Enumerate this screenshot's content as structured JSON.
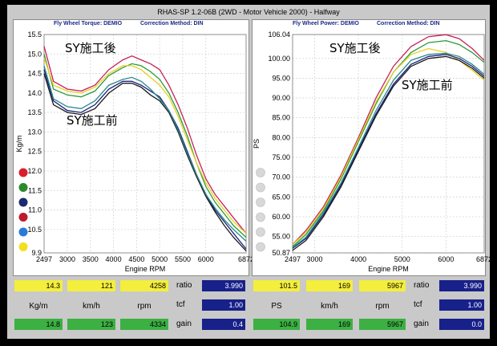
{
  "window_title": "RHAS-SP 1.2-06B  (2WD - Motor Vehicle 2000) - Halfway",
  "panels": {
    "torque": {
      "title": "Fly Wheel Torque: DEMIO",
      "method": "Correction Method: DIN"
    },
    "power": {
      "title": "Fly Wheel Power: DEMIO",
      "method": "Correction Method: DIN"
    }
  },
  "legend_colors": [
    "#d81e2c",
    "#2b8a2b",
    "#1c2a6e",
    "#c0192c",
    "#2a7ad8",
    "#f0e020"
  ],
  "power_dot_color": "#d8d8d8",
  "chart_data": [
    {
      "type": "line",
      "title": "Fly Wheel Torque: DEMIO",
      "xlabel": "Engine RPM",
      "ylabel": "Kg/m",
      "xlim": [
        2497,
        6872
      ],
      "ylim": [
        9.9,
        15.5
      ],
      "xticks": [
        "2497",
        "3000",
        "3500",
        "4000",
        "4500",
        "5000",
        "5500",
        "6000",
        "6872"
      ],
      "yticks": [
        "9.9",
        "10.5",
        "11.0",
        "11.5",
        "12.0",
        "12.5",
        "13.0",
        "13.5",
        "14.0",
        "14.5",
        "15.0",
        "15.5"
      ],
      "annotations": [
        "SY施工後",
        "SY施工前"
      ],
      "series": [
        {
          "color": "#c8205a",
          "x": [
            2497,
            2700,
            3000,
            3300,
            3600,
            3900,
            4200,
            4400,
            4600,
            4800,
            5000,
            5200,
            5400,
            5600,
            5800,
            6000,
            6200,
            6400,
            6600,
            6872
          ],
          "y": [
            15.2,
            14.3,
            14.1,
            14.05,
            14.2,
            14.6,
            14.85,
            14.95,
            14.85,
            14.75,
            14.6,
            14.2,
            13.7,
            13.1,
            12.4,
            11.8,
            11.4,
            11.1,
            10.8,
            10.4
          ]
        },
        {
          "color": "#2a9a3a",
          "x": [
            2497,
            2700,
            3000,
            3300,
            3600,
            3900,
            4200,
            4400,
            4600,
            4800,
            5000,
            5200,
            5400,
            5600,
            5800,
            6000,
            6200,
            6400,
            6600,
            6872
          ],
          "y": [
            15.0,
            14.1,
            13.95,
            13.9,
            14.05,
            14.45,
            14.65,
            14.75,
            14.7,
            14.55,
            14.35,
            14.0,
            13.5,
            12.9,
            12.2,
            11.6,
            11.2,
            10.9,
            10.6,
            10.3
          ]
        },
        {
          "color": "#e8d020",
          "x": [
            2497,
            2700,
            3000,
            3300,
            3600,
            3900,
            4200,
            4400,
            4600,
            4800,
            5000,
            5200,
            5400,
            5600,
            5800,
            6000,
            6200,
            6400,
            6600,
            6872
          ],
          "y": [
            14.9,
            14.2,
            14.05,
            14.0,
            14.15,
            14.5,
            14.7,
            14.7,
            14.6,
            14.4,
            14.2,
            13.9,
            13.4,
            12.8,
            12.2,
            11.7,
            11.3,
            11.0,
            10.7,
            10.4
          ]
        },
        {
          "color": "#1a2080",
          "x": [
            2497,
            2700,
            3000,
            3300,
            3600,
            3900,
            4200,
            4400,
            4600,
            4800,
            5000,
            5200,
            5400,
            5600,
            5800,
            6000,
            6200,
            6400,
            6600,
            6872
          ],
          "y": [
            14.6,
            13.8,
            13.55,
            13.5,
            13.7,
            14.1,
            14.3,
            14.3,
            14.2,
            14.05,
            13.9,
            13.55,
            13.1,
            12.5,
            11.9,
            11.4,
            11.0,
            10.7,
            10.4,
            10.0
          ]
        },
        {
          "color": "#1a1a1a",
          "x": [
            2497,
            2700,
            3000,
            3300,
            3600,
            3900,
            4200,
            4400,
            4600,
            4800,
            5000,
            5200,
            5400,
            5600,
            5800,
            6000,
            6200,
            6400,
            6600,
            6872
          ],
          "y": [
            14.5,
            13.7,
            13.5,
            13.45,
            13.6,
            14.0,
            14.25,
            14.25,
            14.15,
            13.95,
            13.8,
            13.5,
            13.0,
            12.4,
            11.85,
            11.35,
            10.95,
            10.6,
            10.3,
            9.95
          ]
        },
        {
          "color": "#2a8a8a",
          "x": [
            2497,
            2700,
            3000,
            3300,
            3600,
            3900,
            4200,
            4400,
            4600,
            4800,
            5000,
            5200,
            5400,
            5600,
            5800,
            6000,
            6200,
            6400,
            6600,
            6872
          ],
          "y": [
            14.7,
            13.85,
            13.65,
            13.6,
            13.8,
            14.2,
            14.35,
            14.4,
            14.3,
            14.1,
            13.85,
            13.55,
            13.05,
            12.45,
            11.9,
            11.4,
            11.05,
            10.75,
            10.5,
            10.2
          ]
        }
      ]
    },
    {
      "type": "line",
      "title": "Fly Wheel Power: DEMIO",
      "xlabel": "Engine RPM",
      "ylabel": "PS",
      "xlim": [
        2497,
        6872
      ],
      "ylim": [
        50.87,
        106.04
      ],
      "xticks": [
        "2497",
        "3000",
        "4000",
        "5000",
        "6000",
        "6872"
      ],
      "yticks": [
        "50.87",
        "55.00",
        "60.00",
        "65.00",
        "70.00",
        "75.00",
        "80.00",
        "85.00",
        "90.00",
        "95.00",
        "100.00",
        "106.04"
      ],
      "annotations": [
        "SY施工後",
        "SY施工前"
      ],
      "series": [
        {
          "color": "#c8205a",
          "x": [
            2497,
            2800,
            3200,
            3600,
            4000,
            4400,
            4800,
            5200,
            5600,
            6000,
            6300,
            6600,
            6872
          ],
          "y": [
            53.0,
            56.5,
            62.5,
            70.5,
            80.0,
            90.0,
            98.0,
            103.0,
            105.5,
            106.0,
            105.0,
            102.5,
            99.5
          ]
        },
        {
          "color": "#2a9a3a",
          "x": [
            2497,
            2800,
            3200,
            3600,
            4000,
            4400,
            4800,
            5200,
            5600,
            6000,
            6300,
            6600,
            6872
          ],
          "y": [
            52.5,
            55.5,
            61.5,
            69.5,
            79.0,
            88.5,
            96.5,
            101.5,
            104.0,
            104.5,
            103.5,
            101.5,
            99.0
          ]
        },
        {
          "color": "#e8d020",
          "x": [
            2497,
            2800,
            3200,
            3600,
            4000,
            4400,
            4800,
            5200,
            5600,
            6000,
            6300,
            6600,
            6872
          ],
          "y": [
            53.0,
            56.0,
            62.0,
            70.0,
            79.5,
            89.0,
            96.5,
            101.0,
            102.5,
            101.5,
            99.5,
            97.0,
            94.5
          ]
        },
        {
          "color": "#1a2080",
          "x": [
            2497,
            2800,
            3200,
            3600,
            4000,
            4400,
            4800,
            5200,
            5600,
            6000,
            6300,
            6600,
            6872
          ],
          "y": [
            52.0,
            54.5,
            60.5,
            68.0,
            77.0,
            86.0,
            93.5,
            98.5,
            100.5,
            101.0,
            100.0,
            98.0,
            95.5
          ]
        },
        {
          "color": "#1a1a1a",
          "x": [
            2497,
            2800,
            3200,
            3600,
            4000,
            4400,
            4800,
            5200,
            5600,
            6000,
            6300,
            6600,
            6872
          ],
          "y": [
            51.5,
            54.0,
            60.0,
            67.5,
            76.5,
            85.5,
            93.0,
            98.0,
            100.0,
            100.5,
            99.5,
            97.5,
            95.0
          ]
        },
        {
          "color": "#2a8a8a",
          "x": [
            2497,
            2800,
            3200,
            3600,
            4000,
            4400,
            4800,
            5200,
            5600,
            6000,
            6300,
            6600,
            6872
          ],
          "y": [
            52.2,
            54.8,
            61.0,
            68.5,
            77.5,
            86.8,
            94.5,
            99.5,
            101.0,
            101.3,
            100.5,
            98.5,
            96.0
          ]
        }
      ]
    }
  ],
  "readouts": {
    "torque": {
      "row1": [
        "14.3",
        "121",
        "4258"
      ],
      "units": [
        "Kg/m",
        "km/h",
        "rpm"
      ],
      "row3": [
        "14.8",
        "123",
        "4334"
      ],
      "labels": [
        "ratio",
        "tcf",
        "gain"
      ],
      "values": [
        "3.990",
        "1.00",
        "0.4"
      ]
    },
    "power": {
      "row1": [
        "101.5",
        "169",
        "5967"
      ],
      "units": [
        "PS",
        "km/h",
        "rpm"
      ],
      "row3": [
        "104.9",
        "169",
        "5967"
      ],
      "labels": [
        "ratio",
        "tcf",
        "gain"
      ],
      "values": [
        "3.990",
        "1.00",
        "0.0"
      ]
    }
  }
}
